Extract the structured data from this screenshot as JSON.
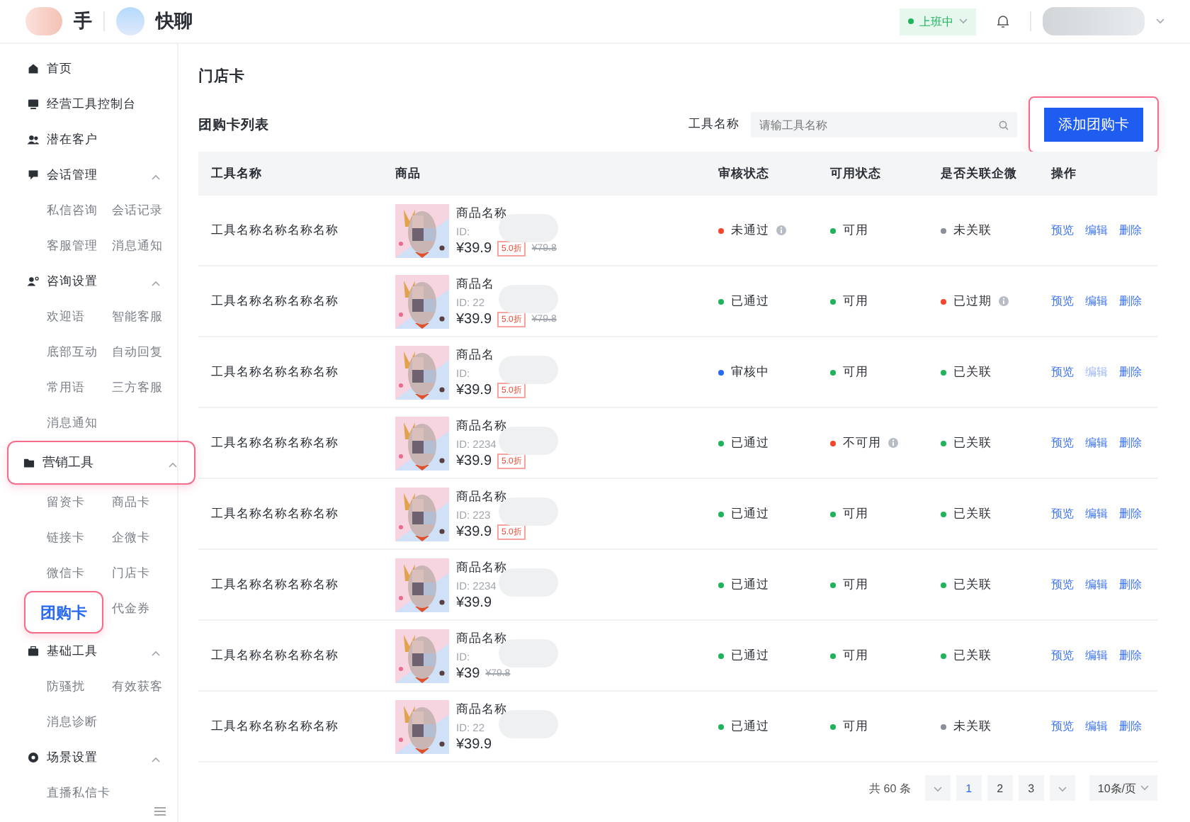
{
  "header": {
    "logo_text": "手",
    "app_name": "快聊",
    "work_status": "上班中"
  },
  "sidebar": {
    "sections": [
      {
        "label": "首页",
        "selected": false
      },
      {
        "label": "经营工具控制台",
        "selected": false
      },
      {
        "label": "潜在客户",
        "selected": false
      },
      {
        "label": "会话管理",
        "expanded": true,
        "selected": false,
        "children": [
          {
            "label": "私信咨询",
            "selected": false
          },
          {
            "label": "会话记录",
            "selected": false
          },
          {
            "label": "客服管理",
            "selected": false
          },
          {
            "label": "消息通知",
            "selected": false
          }
        ]
      },
      {
        "label": "咨询设置",
        "expanded": true,
        "selected": false,
        "children": [
          {
            "label": "欢迎语",
            "selected": false
          },
          {
            "label": "智能客服",
            "selected": false
          },
          {
            "label": "底部互动",
            "selected": false
          },
          {
            "label": "自动回复",
            "selected": false
          },
          {
            "label": "常用语",
            "selected": false
          },
          {
            "label": "三方客服",
            "selected": false
          },
          {
            "label": "消息通知",
            "selected": false
          }
        ]
      },
      {
        "label": "营销工具",
        "expanded": true,
        "selected": true,
        "children": [
          {
            "label": "留资卡",
            "selected": false
          },
          {
            "label": "商品卡",
            "selected": false
          },
          {
            "label": "链接卡",
            "selected": false
          },
          {
            "label": "企微卡",
            "selected": false
          },
          {
            "label": "微信卡",
            "selected": false
          },
          {
            "label": "门店卡",
            "selected": false
          },
          {
            "label": "团购卡",
            "selected": true
          },
          {
            "label": "代金券",
            "selected": false
          }
        ]
      },
      {
        "label": "基础工具",
        "expanded": true,
        "selected": false,
        "children": [
          {
            "label": "防骚扰",
            "selected": false
          },
          {
            "label": "有效获客",
            "selected": false
          },
          {
            "label": "消息诊断",
            "selected": false
          }
        ]
      },
      {
        "label": "场景设置",
        "expanded": true,
        "selected": false,
        "children": [
          {
            "label": "直播私信卡",
            "selected": false
          }
        ]
      }
    ]
  },
  "page_title": "门店卡",
  "list_title": "团购卡列表",
  "search": {
    "label": "工具名称",
    "placeholder": "请输工具名称"
  },
  "add_button": "添加团购卡",
  "table": {
    "columns": [
      "工具名称",
      "商品",
      "审核状态",
      "可用状态",
      "是否关联企微",
      "操作"
    ],
    "rows": [
      {
        "name": "工具名称名称名称名称",
        "product": {
          "title": "商品名称",
          "id": "ID:",
          "price": "¥39.9",
          "discount": "5.0折",
          "original_price": "¥79.8"
        },
        "review": {
          "text": "未通过",
          "color": "#f5452f",
          "info": true
        },
        "availability": {
          "text": "可用",
          "color": "#1fb35b",
          "info": false
        },
        "linked": {
          "text": "未关联",
          "color": "#8a8f99",
          "info": false
        },
        "actions": [
          {
            "label": "预览",
            "disabled": false
          },
          {
            "label": "编辑",
            "disabled": false
          },
          {
            "label": "删除",
            "disabled": false
          }
        ]
      },
      {
        "name": "工具名称名称名称名称",
        "product": {
          "title": "商品名",
          "id": "ID: 22",
          "price": "¥39.9",
          "discount": "5.0折",
          "original_price": "¥79.8"
        },
        "review": {
          "text": "已通过",
          "color": "#1fb35b",
          "info": false
        },
        "availability": {
          "text": "可用",
          "color": "#1fb35b",
          "info": false
        },
        "linked": {
          "text": "已过期",
          "color": "#f5452f",
          "info": true
        },
        "actions": [
          {
            "label": "预览",
            "disabled": false
          },
          {
            "label": "编辑",
            "disabled": false
          },
          {
            "label": "删除",
            "disabled": false
          }
        ]
      },
      {
        "name": "工具名称名称名称名称",
        "product": {
          "title": "商品名",
          "id": "ID:",
          "price": "¥39.9",
          "discount": "5.0折"
        },
        "review": {
          "text": "审核中",
          "color": "#2a6af0",
          "info": false
        },
        "availability": {
          "text": "可用",
          "color": "#1fb35b",
          "info": false
        },
        "linked": {
          "text": "已关联",
          "color": "#1fb35b",
          "info": false
        },
        "actions": [
          {
            "label": "预览",
            "disabled": false
          },
          {
            "label": "编辑",
            "disabled": true
          },
          {
            "label": "删除",
            "disabled": false
          }
        ]
      },
      {
        "name": "工具名称名称名称名称",
        "product": {
          "title": "商品名称",
          "id": "ID: 2234",
          "price": "¥39.9",
          "discount": "5.0折"
        },
        "review": {
          "text": "已通过",
          "color": "#1fb35b",
          "info": false
        },
        "availability": {
          "text": "不可用",
          "color": "#f5452f",
          "info": true
        },
        "linked": {
          "text": "已关联",
          "color": "#1fb35b",
          "info": false
        },
        "actions": [
          {
            "label": "预览",
            "disabled": false
          },
          {
            "label": "编辑",
            "disabled": false
          },
          {
            "label": "删除",
            "disabled": false
          }
        ]
      },
      {
        "name": "工具名称名称名称名称",
        "product": {
          "title": "商品名称",
          "id": "ID: 223",
          "price": "¥39.9",
          "discount": "5.0折"
        },
        "review": {
          "text": "已通过",
          "color": "#1fb35b",
          "info": false
        },
        "availability": {
          "text": "可用",
          "color": "#1fb35b",
          "info": false
        },
        "linked": {
          "text": "已关联",
          "color": "#1fb35b",
          "info": false
        },
        "actions": [
          {
            "label": "预览",
            "disabled": false
          },
          {
            "label": "编辑",
            "disabled": false
          },
          {
            "label": "删除",
            "disabled": false
          }
        ]
      },
      {
        "name": "工具名称名称名称名称",
        "product": {
          "title": "商品名称",
          "id": "ID: 2234",
          "price": "¥39.9"
        },
        "review": {
          "text": "已通过",
          "color": "#1fb35b",
          "info": false
        },
        "availability": {
          "text": "可用",
          "color": "#1fb35b",
          "info": false
        },
        "linked": {
          "text": "已关联",
          "color": "#1fb35b",
          "info": false
        },
        "actions": [
          {
            "label": "预览",
            "disabled": false
          },
          {
            "label": "编辑",
            "disabled": false
          },
          {
            "label": "删除",
            "disabled": false
          }
        ]
      },
      {
        "name": "工具名称名称名称名称",
        "product": {
          "title": "商品名称",
          "id": "ID:",
          "price": "¥39",
          "original_price": "¥79.8"
        },
        "review": {
          "text": "已通过",
          "color": "#1fb35b",
          "info": false
        },
        "availability": {
          "text": "可用",
          "color": "#1fb35b",
          "info": false
        },
        "linked": {
          "text": "已关联",
          "color": "#1fb35b",
          "info": false
        },
        "actions": [
          {
            "label": "预览",
            "disabled": false
          },
          {
            "label": "编辑",
            "disabled": false
          },
          {
            "label": "删除",
            "disabled": false
          }
        ]
      },
      {
        "name": "工具名称名称名称名称",
        "product": {
          "title": "商品名称",
          "id": "ID: 22",
          "price": "¥39.9"
        },
        "review": {
          "text": "已通过",
          "color": "#1fb35b",
          "info": false
        },
        "availability": {
          "text": "可用",
          "color": "#1fb35b",
          "info": false
        },
        "linked": {
          "text": "未关联",
          "color": "#8a8f99",
          "info": false
        },
        "actions": [
          {
            "label": "预览",
            "disabled": false
          },
          {
            "label": "编辑",
            "disabled": false
          },
          {
            "label": "删除",
            "disabled": false
          }
        ]
      }
    ]
  },
  "pagination": {
    "total": "共 60 条",
    "pages": [
      {
        "label": "1",
        "selected": true
      },
      {
        "label": "2",
        "selected": false
      },
      {
        "label": "3",
        "selected": false
      }
    ],
    "page_size": "10条/页"
  }
}
